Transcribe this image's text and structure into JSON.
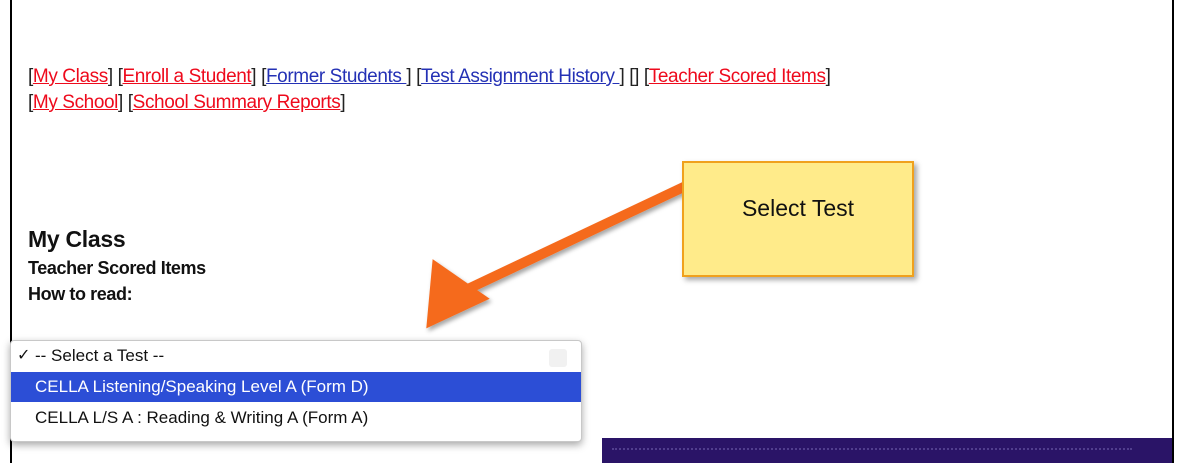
{
  "nav": {
    "row1": [
      {
        "label": "My Class",
        "color": "#ee0a1c"
      },
      {
        "label": "Enroll a Student",
        "color": "#ee0a1c"
      },
      {
        "label": "Former Students ",
        "color": "#2431b5"
      },
      {
        "label": "Test Assignment History ",
        "color": "#2431b5"
      },
      {
        "label": "Teacher Scored Items",
        "color": "#ee0a1c"
      }
    ],
    "empty_bracket": "[]",
    "row2": [
      {
        "label": "My School",
        "color": "#ee0a1c"
      },
      {
        "label": "School Summary Reports",
        "color": "#ee0a1c"
      }
    ]
  },
  "page": {
    "title": "My Class",
    "subtitle": "Teacher Scored Items",
    "how_to_read": "How to read:"
  },
  "test_select": {
    "options": [
      "-- Select a Test --",
      "CELLA Listening/Speaking Level A (Form D)",
      "CELLA L/S A : Reading & Writing A (Form A)"
    ],
    "checked_index": 0,
    "highlighted_index": 1,
    "checkmark": "✓"
  },
  "callout": {
    "text": "Select Test",
    "fill_color": "#ffeb8a",
    "border_color": "#f0a11d",
    "arrow_color": "#f56b1d"
  }
}
